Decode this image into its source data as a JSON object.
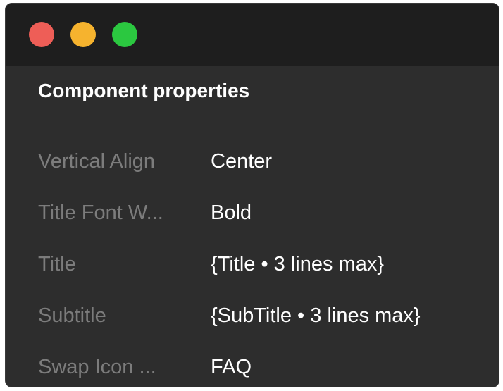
{
  "window": {
    "controls": {
      "close_color": "#ee5e57",
      "minimize_color": "#f6b32e",
      "maximize_color": "#2bc840"
    }
  },
  "panel": {
    "title": "Component properties",
    "properties": [
      {
        "label": "Vertical Align",
        "value": "Center"
      },
      {
        "label": "Title Font W...",
        "value": "Bold"
      },
      {
        "label": "Title",
        "value": "{Title • 3 lines max}"
      },
      {
        "label": "Subtitle",
        "value": "{SubTitle • 3 lines max}"
      },
      {
        "label": "Swap Icon ...",
        "value": "FAQ"
      }
    ]
  }
}
